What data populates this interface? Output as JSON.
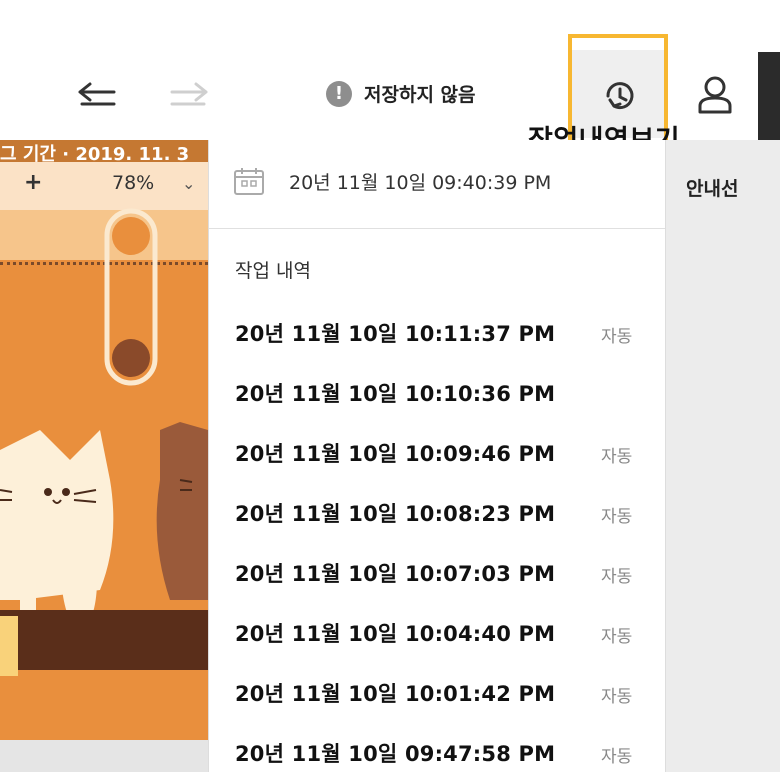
{
  "toolbar": {
    "unsaved_icon": "warning-icon",
    "unsaved_label": "저장하지 않음",
    "history_tooltip": "작업내역보기",
    "accent_color": "#f7b731"
  },
  "canvas": {
    "title_partial": "그 기간 · 2019. 11. 3",
    "zoom_plus": "+",
    "zoom_value": "78%",
    "zoom_chevron": "⌄"
  },
  "guide": {
    "label": "안내선"
  },
  "history_panel": {
    "current_time": "20년 11월 10일 09:40:39 PM",
    "section_title": "작업 내역",
    "items": [
      {
        "time": "20년 11월 10일 10:11:37 PM",
        "tag": "자동"
      },
      {
        "time": "20년 11월 10일 10:10:36 PM",
        "tag": ""
      },
      {
        "time": "20년 11월 10일 10:09:46 PM",
        "tag": "자동"
      },
      {
        "time": "20년 11월 10일 10:08:23 PM",
        "tag": "자동"
      },
      {
        "time": "20년 11월 10일 10:07:03 PM",
        "tag": "자동"
      },
      {
        "time": "20년 11월 10일 10:04:40 PM",
        "tag": "자동"
      },
      {
        "time": "20년 11월 10일 10:01:42 PM",
        "tag": "자동"
      },
      {
        "time": "20년 11월 10일 09:47:58 PM",
        "tag": "자동"
      }
    ]
  }
}
